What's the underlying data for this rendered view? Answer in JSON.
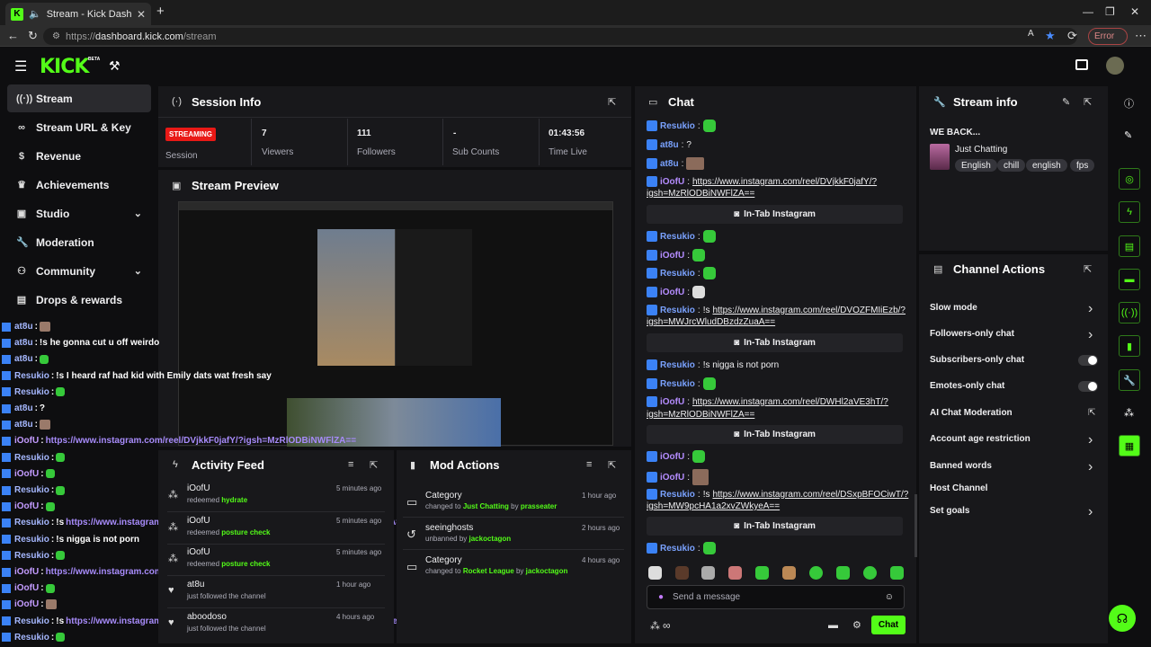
{
  "browser": {
    "tab_title": "Stream - Kick Dashboard",
    "url_proto": "https://",
    "url_host": "dashboard.kick.com",
    "url_path": "/stream",
    "error_label": "Error"
  },
  "app": {
    "logo": "KICK",
    "beta": "BETA"
  },
  "sidebar": {
    "items": [
      {
        "label": "Stream",
        "icon": "broadcast-icon"
      },
      {
        "label": "Stream URL & Key",
        "icon": "link-icon"
      },
      {
        "label": "Revenue",
        "icon": "dollar-icon"
      },
      {
        "label": "Achievements",
        "icon": "trophy-icon"
      },
      {
        "label": "Studio",
        "icon": "studio-icon"
      },
      {
        "label": "Moderation",
        "icon": "wrench-icon"
      },
      {
        "label": "Community",
        "icon": "users-icon"
      },
      {
        "label": "Drops & rewards",
        "icon": "gift-icon"
      }
    ]
  },
  "session": {
    "title": "Session Info",
    "badge": "STREAMING",
    "session_label": "Session",
    "viewers": "7",
    "viewers_label": "Viewers",
    "followers": "111",
    "followers_label": "Followers",
    "subs": "-",
    "subs_label": "Sub Counts",
    "time_live": "01:43:56",
    "time_label": "Time Live"
  },
  "preview": {
    "title": "Stream Preview"
  },
  "overlay_chat": [
    {
      "user": "at8u",
      "text": "",
      "kind": "thumb"
    },
    {
      "user": "at8u",
      "text": "!s he gonna cut u off weirdo"
    },
    {
      "user": "at8u",
      "text": "",
      "kind": "gem"
    },
    {
      "user": "Resukio",
      "text": "!s I heard raf had kid with Emily dats wat fresh say"
    },
    {
      "user": "Resukio",
      "text": "",
      "kind": "gem"
    },
    {
      "user": "at8u",
      "text": "?"
    },
    {
      "user": "at8u",
      "text": "",
      "kind": "thumb"
    },
    {
      "user": "iOofU",
      "text": "https://www.instagram.com/reel/DVjkkF0jafY/?igsh=MzRlODBiNWFlZA==",
      "kind": "link"
    },
    {
      "user": "Resukio",
      "text": "",
      "kind": "gem"
    },
    {
      "user": "iOofU",
      "text": "",
      "kind": "gem"
    },
    {
      "user": "Resukio",
      "text": "",
      "kind": "gem"
    },
    {
      "user": "iOofU",
      "text": "",
      "kind": "gem"
    },
    {
      "user": "Resukio",
      "text": "!s",
      "link": "https://www.instagram.com/reel/DVOZFMIiEzb/?igsh=MWJrcWludDBzdzZuaA=="
    },
    {
      "user": "Resukio",
      "text": "!s nigga is not porn"
    },
    {
      "user": "Resukio",
      "text": "",
      "kind": "gem"
    },
    {
      "user": "iOofU",
      "text": "https://www.instagram.com/reel/DWHl2aVE3hT/?igsh=MzRlODBiNWFlZA==",
      "kind": "link"
    },
    {
      "user": "iOofU",
      "text": "",
      "kind": "gem"
    },
    {
      "user": "iOofU",
      "text": "",
      "kind": "thumb"
    },
    {
      "user": "Resukio",
      "text": "!s",
      "link": "https://www.instagram.com/reel/DSxpBFOCiwT/?igsh=MW9pcHA1a2xvZWkyeA=="
    },
    {
      "user": "Resukio",
      "text": "",
      "kind": "gem"
    }
  ],
  "activity": {
    "title": "Activity Feed",
    "items": [
      {
        "name": "iOofU",
        "action": "redeemed",
        "reward": "hydrate",
        "time": "5 minutes ago"
      },
      {
        "name": "iOofU",
        "action": "redeemed",
        "reward": "posture check",
        "time": "5 minutes ago"
      },
      {
        "name": "iOofU",
        "action": "redeemed",
        "reward": "posture check",
        "time": "5 minutes ago"
      },
      {
        "name": "at8u",
        "action": "just followed the channel",
        "reward": "",
        "time": "1 hour ago"
      },
      {
        "name": "aboodoso",
        "action": "just followed the channel",
        "reward": "",
        "time": "4 hours ago"
      }
    ]
  },
  "mod": {
    "title": "Mod Actions",
    "items": [
      {
        "title": "Category",
        "pre": "changed to",
        "target": "Just Chatting",
        "by": "by",
        "mod": "prasseater",
        "time": "1 hour ago"
      },
      {
        "title": "seeinghosts",
        "pre": "unbanned by",
        "target": "",
        "by": "",
        "mod": "jackoctagon",
        "time": "2 hours ago"
      },
      {
        "title": "Category",
        "pre": "changed to",
        "target": "Rocket League",
        "by": "by",
        "mod": "jackoctagon",
        "time": "4 hours ago"
      }
    ]
  },
  "chat": {
    "title": "Chat",
    "intab_label": "In-Tab Instagram",
    "link1a": "https://www.instagram.com/reel/DVjkkF0jafY/?",
    "link1b": "igsh=MzRlODBiNWFlZA==",
    "link2a": "https://www.instagram.com/reel/DVOZFMIiEzb/?",
    "link2b": "igsh=MWJrcWludDBzdzZuaA==",
    "link3a": "https://www.instagram.com/reel/DWHl2aVE3hT/?",
    "link3b": "igsh=MzRlODBiNWFlZA==",
    "link4a": "https://www.instagram.com/reel/DSxpBFOCiwT/?",
    "link4b": "igsh=MW9pcHA1a2xvZWkyeA==",
    "msg_nigga": "!s nigga is not porn",
    "q": "?",
    "bang": "!s",
    "placeholder": "Send a message",
    "send": "Chat"
  },
  "users": {
    "resukio": "Resukio",
    "at8u": "at8u",
    "ioofu": "iOofU"
  },
  "stream_info": {
    "title": "Stream info",
    "stream_title": "WE BACK...",
    "category": "Just Chatting",
    "tags": [
      "English",
      "chill",
      "english",
      "fps"
    ]
  },
  "channel_actions": {
    "title": "Channel Actions",
    "items": [
      {
        "label": "Slow mode",
        "control": "chevron"
      },
      {
        "label": "Followers-only chat",
        "control": "chevron"
      },
      {
        "label": "Subscribers-only chat",
        "control": "toggle"
      },
      {
        "label": "Emotes-only chat",
        "control": "toggle"
      },
      {
        "label": "AI Chat Moderation",
        "control": "external"
      },
      {
        "label": "Account age restriction",
        "control": "chevron"
      },
      {
        "label": "Banned words",
        "control": "chevron"
      },
      {
        "label": "Host Channel",
        "control": "none"
      },
      {
        "label": "Set goals",
        "control": "chevron"
      }
    ]
  },
  "colors": {
    "brand": "#53fc18",
    "live": "#e91916",
    "panel": "#18181b"
  }
}
